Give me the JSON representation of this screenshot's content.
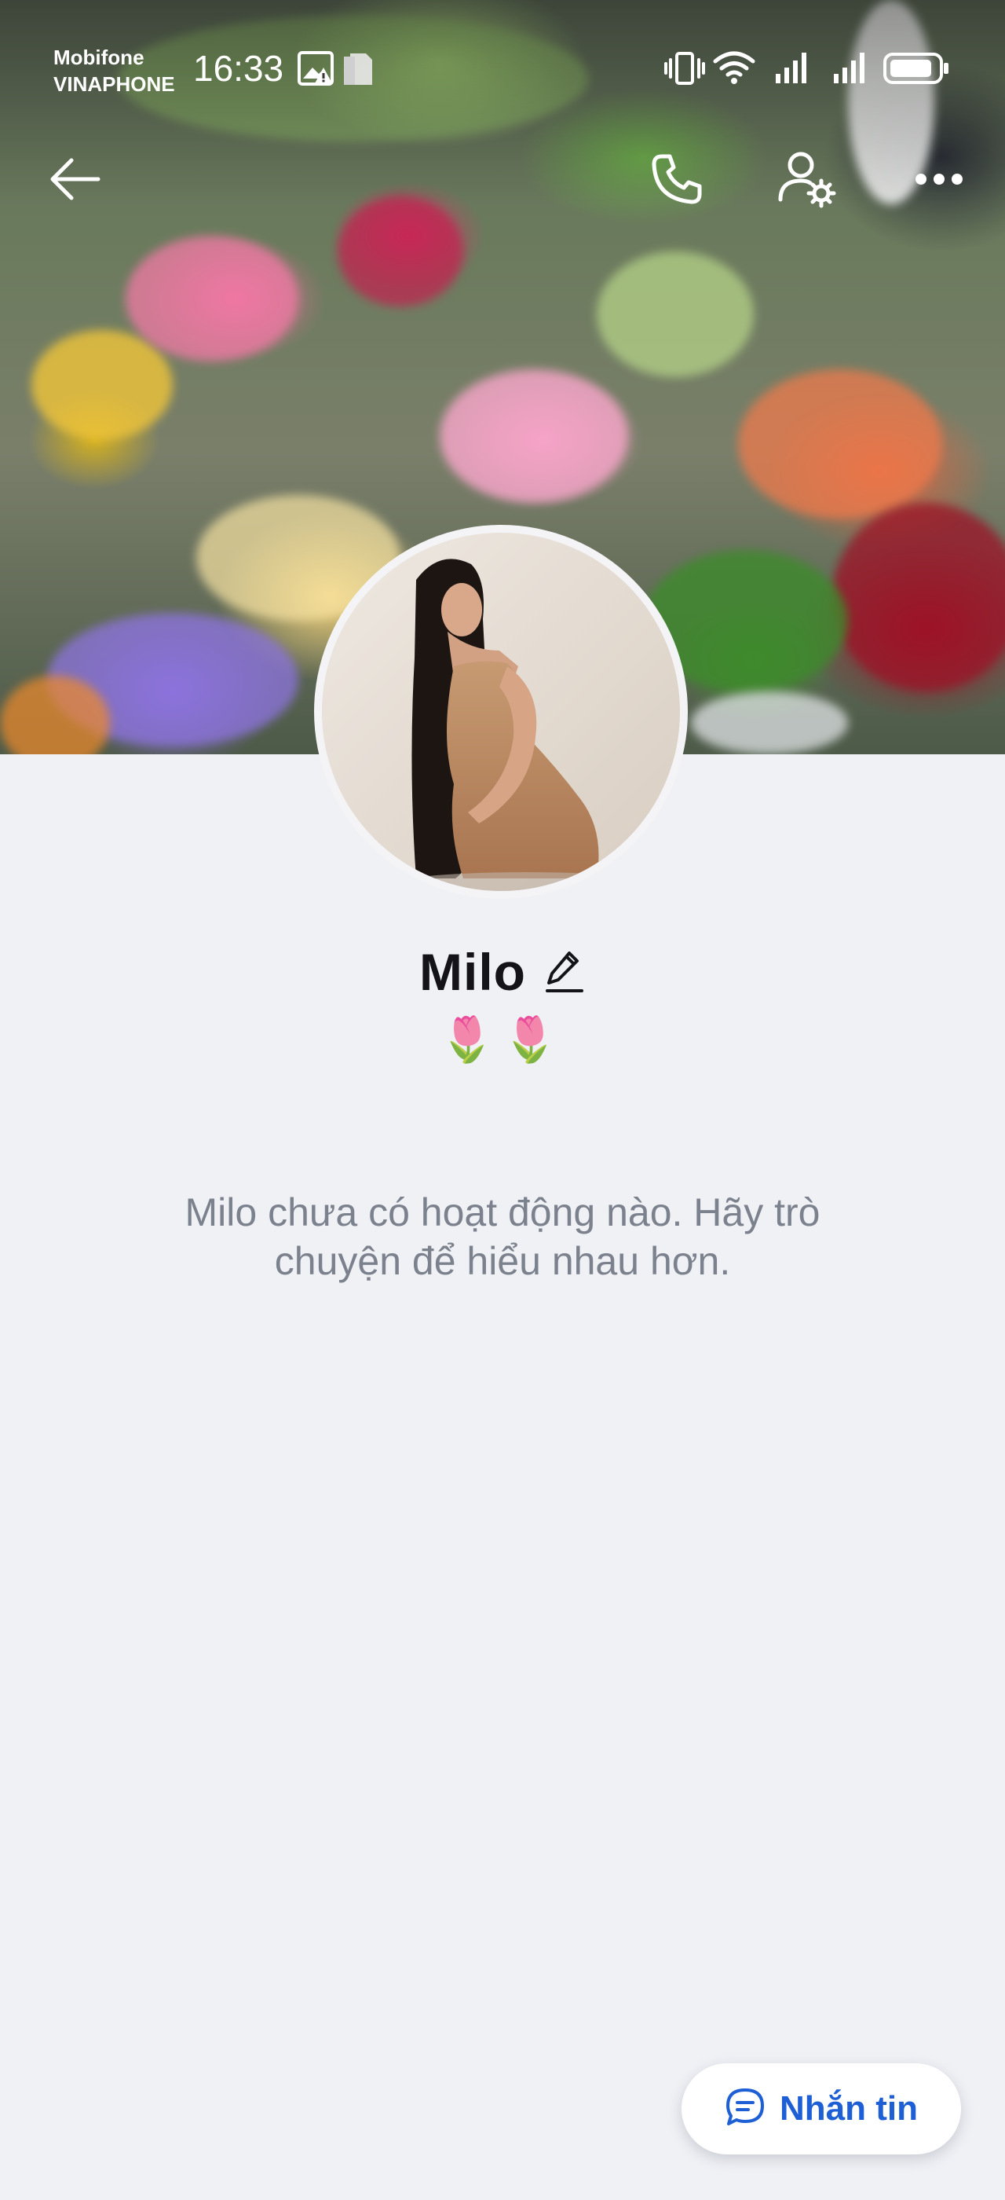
{
  "status_bar": {
    "carrier_1": "Mobifone",
    "carrier_2": "VINAPHONE",
    "time": "16:33",
    "icons": [
      "image-icon",
      "alert-icon",
      "sim-icon",
      "vibrate-icon",
      "wifi-icon",
      "signal-icon",
      "signal-icon",
      "battery-icon"
    ]
  },
  "nav": {
    "icons": [
      "back-arrow-icon",
      "phone-icon",
      "user-settings-icon",
      "more-icon"
    ]
  },
  "profile": {
    "name": "Milo",
    "bio": "🌷🌷",
    "empty_message": "Milo chưa có hoạt động nào. Hãy trò chuyện để hiểu nhau hơn."
  },
  "action": {
    "message_label": "Nhắn tin",
    "icon": "chat-bubble-icon",
    "accent": "#1f5fd6"
  },
  "colors": {
    "background": "#f0f1f5",
    "text_primary": "#141418",
    "text_secondary": "#7b818d"
  }
}
